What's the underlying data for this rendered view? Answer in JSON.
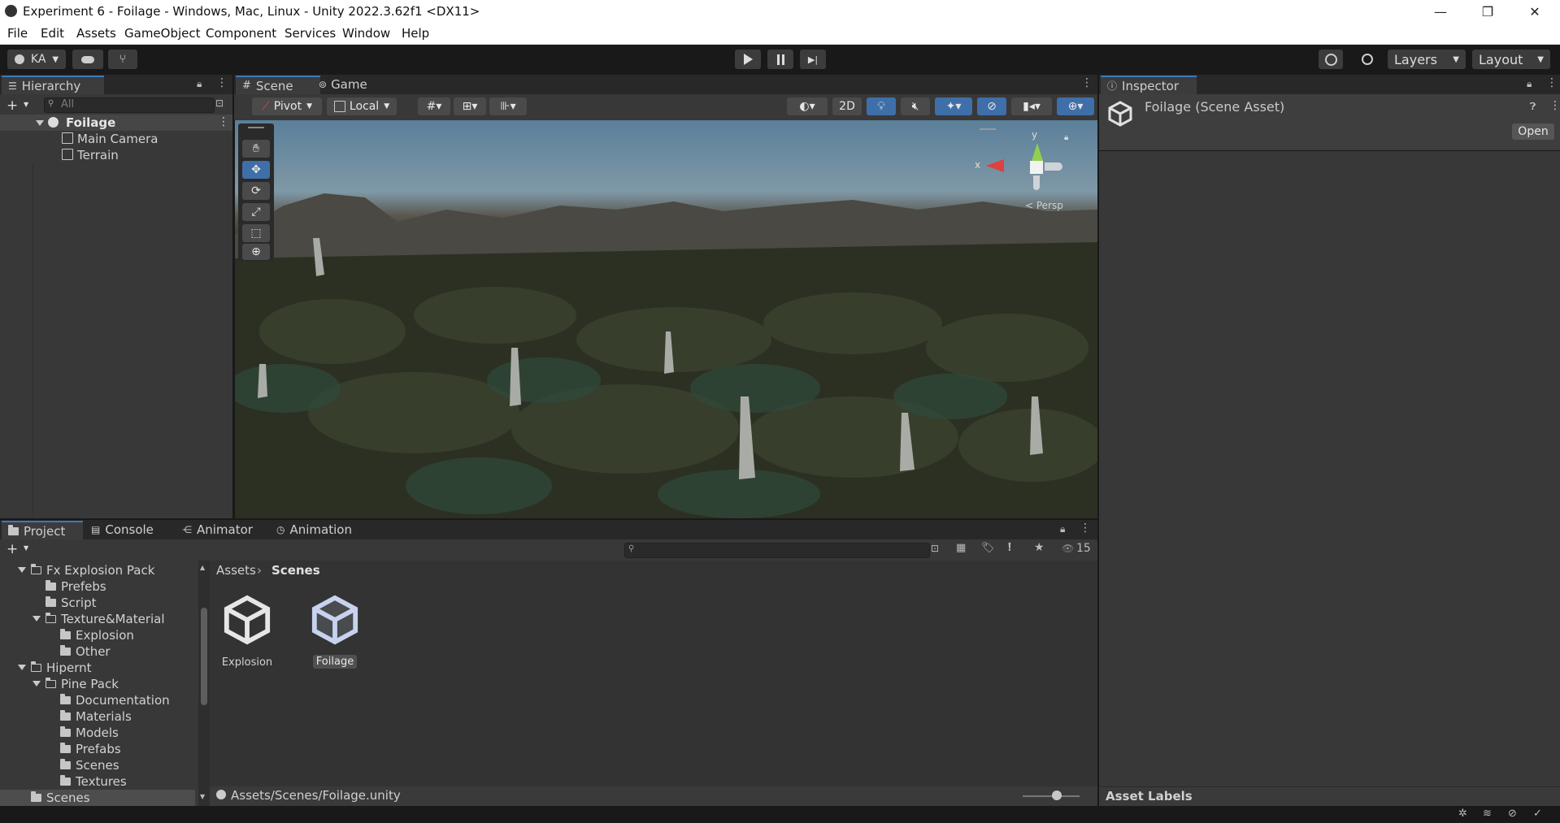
{
  "window": {
    "title": "Experiment 6 - Foilage - Windows, Mac, Linux - Unity 2022.3.62f1 <DX11>",
    "controls": [
      "—",
      "❐",
      "✕"
    ]
  },
  "menu": [
    "File",
    "Edit",
    "Assets",
    "GameObject",
    "Component",
    "Services",
    "Window",
    "Help"
  ],
  "toolbar": {
    "account": "KA",
    "layers": "Layers",
    "layout": "Layout"
  },
  "hierarchy": {
    "tab": "Hierarchy",
    "search_placeholder": "All",
    "scene": "Foilage",
    "items": [
      "Main Camera",
      "Terrain"
    ]
  },
  "scene_tabs": [
    "Scene",
    "Game"
  ],
  "scene_toolbar": {
    "pivot": "Pivot",
    "local": "Local",
    "mode2d": "2D"
  },
  "gizmo": {
    "y": "y",
    "x": "x",
    "persp": "< Persp"
  },
  "inspector": {
    "tab": "Inspector",
    "title": "Foilage (Scene Asset)",
    "open_button": "Open",
    "asset_labels": "Asset Labels"
  },
  "bottom_tabs": [
    "Project",
    "Console",
    "Animator",
    "Animation"
  ],
  "project": {
    "hidden_count": "15",
    "tree": [
      {
        "label": "Fx Explosion Pack",
        "depth": 1,
        "expanded": true
      },
      {
        "label": "Prefebs",
        "depth": 2
      },
      {
        "label": "Script",
        "depth": 2
      },
      {
        "label": "Texture&Material",
        "depth": 2,
        "expanded": true
      },
      {
        "label": "Explosion",
        "depth": 3
      },
      {
        "label": "Other",
        "depth": 3
      },
      {
        "label": "Hipernt",
        "depth": 1,
        "expanded": true
      },
      {
        "label": "Pine Pack",
        "depth": 2,
        "expanded": true
      },
      {
        "label": "Documentation",
        "depth": 3
      },
      {
        "label": "Materials",
        "depth": 3
      },
      {
        "label": "Models",
        "depth": 3
      },
      {
        "label": "Prefabs",
        "depth": 3
      },
      {
        "label": "Scenes",
        "depth": 3
      },
      {
        "label": "Textures",
        "depth": 3
      },
      {
        "label": "Scenes",
        "depth": 1,
        "selected": true
      }
    ],
    "breadcrumb": [
      "Assets",
      "Scenes"
    ],
    "assets": [
      "Explosion",
      "Foilage"
    ],
    "selected_asset": "Foilage",
    "path": "Assets/Scenes/Foilage.unity"
  }
}
